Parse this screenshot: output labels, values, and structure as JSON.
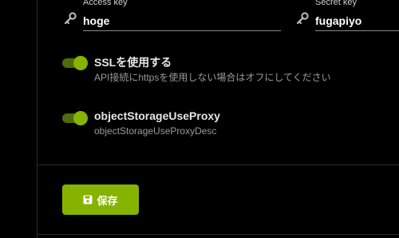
{
  "credentials": {
    "access_key": {
      "label": "Access key",
      "value": "hoge",
      "icon": "key-icon"
    },
    "secret_key": {
      "label": "Secret key",
      "value": "fugapiyo",
      "icon": "key-icon"
    }
  },
  "toggles": [
    {
      "title": "SSLを使用する",
      "description": "API接続にhttpsを使用しない場合はオフにしてください",
      "enabled": true
    },
    {
      "title": "objectStorageUseProxy",
      "description": "objectStorageUseProxyDesc",
      "enabled": true
    }
  ],
  "actions": {
    "save_label": "保存",
    "save_icon": "floppy-disk-icon"
  },
  "colors": {
    "accent": "#86b300",
    "toggle_track": "#4f6b0c",
    "background": "#000000",
    "text_primary": "#e6e6e6",
    "text_secondary": "#9a9a9a"
  }
}
